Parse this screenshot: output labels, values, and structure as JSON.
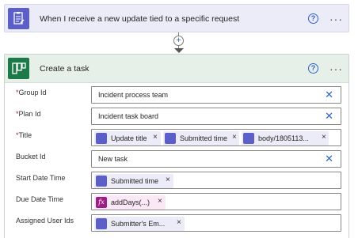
{
  "trigger": {
    "title": "When I receive a new update tied to a specific request",
    "help": "?",
    "more": "···",
    "icon": "form-icon"
  },
  "connector": {
    "add_label": "+"
  },
  "task": {
    "title": "Create a task",
    "help": "?",
    "more": "···",
    "icon": "planner-icon",
    "fields": {
      "group_id": {
        "label": "Group Id",
        "required": "*",
        "value": "Incident process team"
      },
      "plan_id": {
        "label": "Plan Id",
        "required": "*",
        "value": "Incident task board"
      },
      "title": {
        "label": "Title",
        "required": "*",
        "tokens": [
          "Update title",
          "Submitted time",
          "body/1805113..."
        ]
      },
      "bucket_id": {
        "label": "Bucket Id",
        "value": "New task"
      },
      "start_date": {
        "label": "Start Date Time",
        "tokens": [
          "Submitted time"
        ]
      },
      "due_date": {
        "label": "Due Date Time",
        "tokens": [
          "addDays(...)"
        ],
        "fx": "fx"
      },
      "assigned": {
        "label": "Assigned User Ids",
        "tokens": [
          "Submitter's Em..."
        ]
      }
    }
  },
  "remove_glyph": "×",
  "clear_glyph": "✕",
  "colors": {
    "accent": "#2b63c9",
    "token_bg": "#ecebf8",
    "forms": "#5b5fc7",
    "planner": "#1b7a47",
    "expression": "#9e1e86"
  }
}
